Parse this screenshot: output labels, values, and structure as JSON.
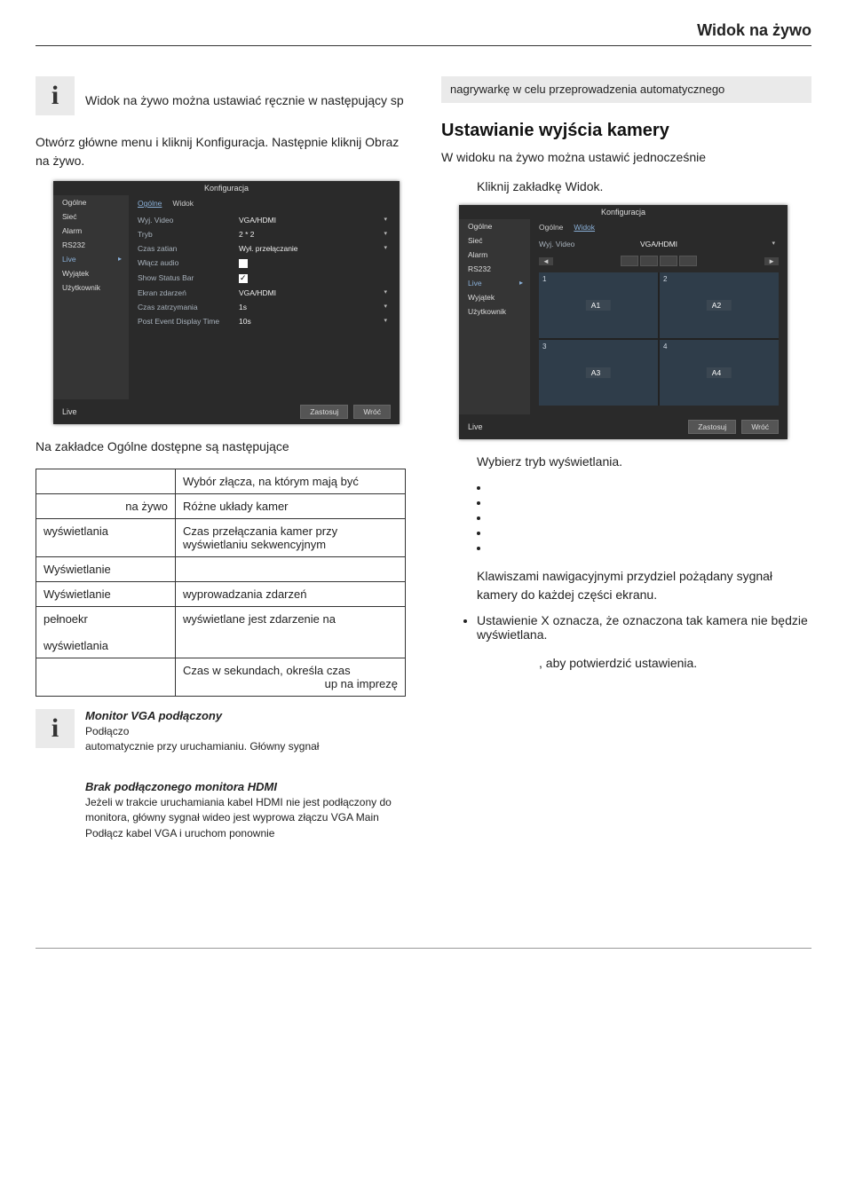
{
  "header": {
    "title": "Widok na żywo"
  },
  "left": {
    "info_text": "Widok na żywo można ustawiać ręcznie w następujący sp",
    "intro": "Otwórz główne menu i kliknij Konfiguracja. Następnie kliknij Obraz na żywo.",
    "caption": "Na zakładce Ogólne dostępne są następujące",
    "table": [
      {
        "k": "",
        "v": "Wybór złącza, na którym mają być"
      },
      {
        "k": "na żywo",
        "v": "Różne układy kamer"
      },
      {
        "k": "wyświetlania",
        "v": "Czas przełączania kamer przy wyświetlaniu sekwencyjnym"
      },
      {
        "k": "Wyświetlanie",
        "v": ""
      },
      {
        "k": "Wyświetlanie",
        "v": "wyprowadzania zdarzeń"
      },
      {
        "k": "pełnoekr",
        "v": "wyświetlane jest zdarzenie na"
      },
      {
        "k": "wyświetlania",
        "v": ""
      },
      {
        "k": "",
        "v": "Czas w sekundach, określa czas"
      },
      {
        "k": "",
        "v": "up na imprezę"
      }
    ],
    "note1_title": "Monitor VGA podłączony",
    "note1_body": "Podłączo\nautomatycznie przy uruchamianiu. Główny sygnał",
    "note2_title": "Brak podłączonego monitora HDMI",
    "note2_body": "Jeżeli w trakcie uruchamiania kabel HDMI nie jest podłączony do monitora, główny sygnał wideo jest wyprowa złączu VGA Main Podłącz kabel VGA i uruchom ponownie"
  },
  "right": {
    "gray": "nagrywarkę w celu przeprowadzenia automatycznego",
    "h2": "Ustawianie wyjścia kamery",
    "sub": "W widoku na żywo można ustawić jednocześnie",
    "step1": "Kliknij zakładkę Widok.",
    "step2": "Wybierz tryb wyświetlania.",
    "assign": "Klawiszami nawigacyjnymi przydziel pożądany sygnał kamery do każdej części ekranu.",
    "dash": "Ustawienie X oznacza, że oznaczona tak kamera nie będzie wyświetlana.",
    "confirm": ", aby potwierdzić ustawienia."
  },
  "nvr1": {
    "title": "Konfiguracja",
    "side": [
      "Ogólne",
      "Sieć",
      "Alarm",
      "RS232",
      "Live",
      "Wyjątek",
      "Użytkownik"
    ],
    "side_selected": "Live",
    "tabs": [
      "Ogólne",
      "Widok"
    ],
    "tab_active": "Ogólne",
    "rows": [
      {
        "label": "Wyj. Video",
        "value": "VGA/HDMI",
        "dd": true
      },
      {
        "label": "Tryb",
        "value": "2 * 2",
        "dd": true
      },
      {
        "label": "Czas zatian",
        "value": "Wył. przełączanie",
        "dd": true
      },
      {
        "label": "Włącz audio",
        "check": false
      },
      {
        "label": "Show Status Bar",
        "check": true
      },
      {
        "label": "Ekran zdarzeń",
        "value": "VGA/HDMI",
        "dd": true
      },
      {
        "label": "Czas zatrzymania",
        "value": "1s",
        "dd": true
      },
      {
        "label": "Post Event Display Time",
        "value": "10s",
        "dd": true
      }
    ],
    "foot_left": "Live",
    "btn1": "Zastosuj",
    "btn2": "Wróć"
  },
  "nvr2": {
    "title": "Konfiguracja",
    "side": [
      "Ogólne",
      "Sieć",
      "Alarm",
      "RS232",
      "Live",
      "Wyjątek",
      "Użytkownik"
    ],
    "side_selected": "Live",
    "tabs": [
      "Ogólne",
      "Widok"
    ],
    "tab_active": "Widok",
    "row_label": "Wyj. Video",
    "row_value": "VGA/HDMI",
    "cells": [
      "A1",
      "A2",
      "A3",
      "A4"
    ],
    "pager_prev": "◄",
    "pager_next": "►",
    "foot_left": "Live",
    "btn1": "Zastosuj",
    "btn2": "Wróć"
  }
}
